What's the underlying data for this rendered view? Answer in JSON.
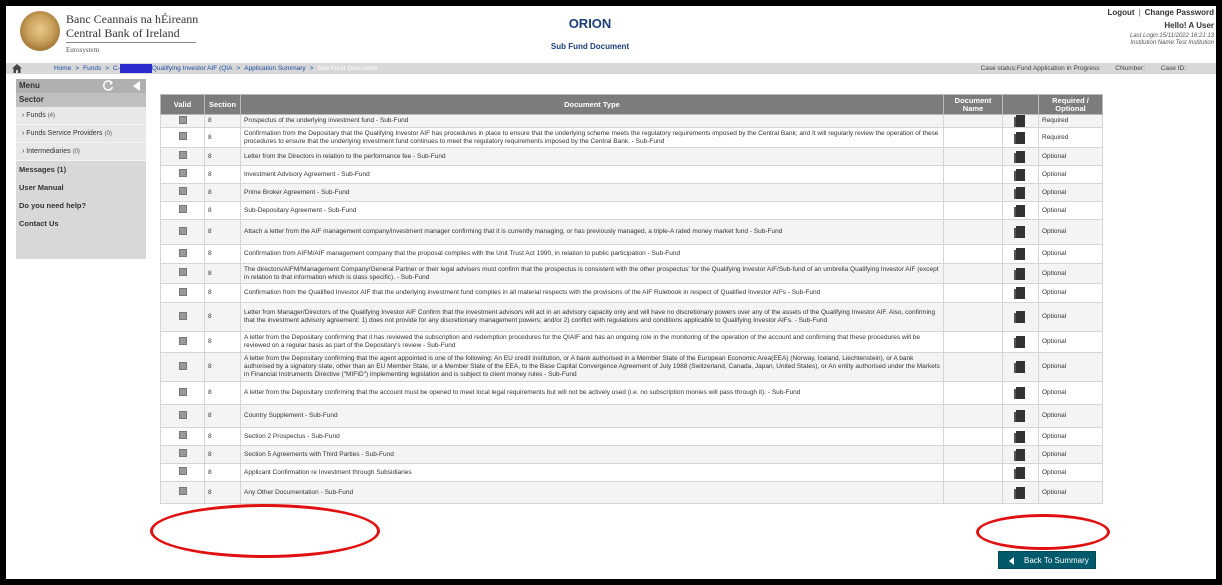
{
  "header": {
    "bank_name_irish": "Banc Ceannais na hÉireann",
    "bank_name_english": "Central Bank of Ireland",
    "eurosystem": "Eurosystem",
    "app_title": "ORION",
    "page_title": "Sub Fund Document",
    "logout": "Logout",
    "separator": "|",
    "change_password": "Change Password",
    "greeting": "Hello! A User",
    "last_login": "Last Login:15/11/2022 16:21:13",
    "institution": "Institution Name:Test Institution"
  },
  "breadcrumb": {
    "home": "Home",
    "funds": "Funds",
    "fund_prefix": "C-",
    "qiaif": "Qualifying Investor AIF (QIA",
    "app_summary": "Application Summary",
    "current": "Sub Fund Document",
    "sep": ">"
  },
  "case_info": {
    "status": "Case status:Fund Application in Progress",
    "cnumber": "CNumber:",
    "case_id": "Case ID:"
  },
  "sidebar": {
    "menu": "Menu",
    "sector": "Sector",
    "items": [
      {
        "label": "› Funds",
        "count": "(4)"
      },
      {
        "label": "› Funds Service Providers",
        "count": "(0)"
      },
      {
        "label": "› Intermediaries",
        "count": "(0)"
      }
    ],
    "messages": "Messages (1)",
    "user_manual": "User Manual",
    "help": "Do you need help?",
    "contact": "Contact Us"
  },
  "table": {
    "headers": {
      "valid": "Valid",
      "section": "Section",
      "doc_type": "Document Type",
      "doc_name": "Document Name",
      "req_opt": "Required / Optional"
    },
    "rows": [
      {
        "section": "8",
        "doc_type": "Prospectus of the underlying investment fund - Sub-Fund",
        "req": "Required"
      },
      {
        "section": "8",
        "doc_type": "Confirmation from the Depositary that the Qualifying Investor AIF has procedures in place to ensure that the underlying scheme meets the regulatory requirements imposed by the Central Bank; and It will regularly review the operation of these procedures to ensure that the underlying investment fund continues to meet the regulatory requirements imposed by the Central Bank. - Sub-Fund",
        "req": "Required"
      },
      {
        "section": "8",
        "doc_type": "Letter from the Directors in relation to the performance fee - Sub-Fund",
        "req": "Optional"
      },
      {
        "section": "8",
        "doc_type": "Investment Advisory Agreement - Sub-Fund",
        "req": "Optional"
      },
      {
        "section": "8",
        "doc_type": "Prime Broker Agreement - Sub-Fund",
        "req": "Optional"
      },
      {
        "section": "8",
        "doc_type": "Sub-Depositary Agreement - Sub-Fund",
        "req": "Optional"
      },
      {
        "section": "8",
        "doc_type": "Attach a letter from the AIF management company/investment manager confirming that it is currently managing, or has previously managed, a triple-A rated money market fund - Sub-Fund",
        "req": "Optional"
      },
      {
        "section": "8",
        "doc_type": "Confirmation from AIFM/AIF management company that the proposal complies with the Unit Trust Act 1990, in relation to public participation - Sub-Fund",
        "req": "Optional"
      },
      {
        "section": "8",
        "doc_type": "The directors/AIFM/Management Company/General Partner or their legal advisers must confirm that the prospectus is consistent with the other prospectus' for the Qualifying Investor AIF/Sub-fund of an umbrella Qualifying Investor AIF (except in relation to that information which is class specific). - Sub-Fund",
        "req": "Optional"
      },
      {
        "section": "8",
        "doc_type": "Confirmation from the Qualified Investor AIF that the underlying investment fund complies in all material respects with the provisions of the AIF Rulebook in respect of Qualified Investor AIFs - Sub-Fund",
        "req": "Optional"
      },
      {
        "section": "8",
        "doc_type": "Letter from Manager/Directors of the Qualifying Investor AIF Confirm that the investment advisors will act in an advisory capacity only and will have no discretionary powers over any of the assets of the Qualifying Investor AIF. Also, confirming that the investment advisory agreement: 1) does not provide for any discretionary management powers; and/or 2) conflict with regulations and conditions applicable to Qualifying Investor AIFs. - Sub-Fund",
        "req": "Optional"
      },
      {
        "section": "8",
        "doc_type": "A letter from the Depositary confirming that it has reviewed the subscription and redemption procedures for the QIAIF and has an ongoing role in the monitoring of the operation of the account and confirming that these procedures will be reviewed on a regular basis as part of the Depositary's review - Sub-Fund",
        "req": "Optional"
      },
      {
        "section": "8",
        "doc_type": "A letter from the Depositary confirming that the agent appointed is one of the following: An EU credit institution, or A bank authorised in a Member State of the European Economic Area(EEA) (Norway, Iceland, Liechtenstein), or A bank authorised by a signatory state, other than an EU Member State, or a Member State of the EEA, to the Base Capital Convergence Agreement of July 1988 (Switzerland, Canada, Japan, United States), or An entity authorised under the Markets in Financial Instruments Directive (\"MIFID\") implementing legislation and is subject to client money rules - Sub-Fund",
        "req": "Optional"
      },
      {
        "section": "8",
        "doc_type": "A letter from the Depositary confirming that the account must be opened to meet local legal requirements but will not be actively used (i.e. no subscription monies will pass through it). - Sub-Fund",
        "req": "Optional"
      },
      {
        "section": "8",
        "doc_type": "Country Supplement - Sub-Fund",
        "req": "Optional"
      },
      {
        "section": "8",
        "doc_type": "Section 2 Prospectus - Sub-Fund",
        "req": "Optional"
      },
      {
        "section": "8",
        "doc_type": "Section 5 Agreements with Third Parties - Sub-Fund",
        "req": "Optional"
      },
      {
        "section": "8",
        "doc_type": "Applicant Confirmation re Investment through Subsidiaries",
        "req": "Optional"
      },
      {
        "section": "8",
        "doc_type": "Any Other Documentation - Sub-Fund",
        "req": "Optional"
      }
    ]
  },
  "back_button": "Back To Summary",
  "colors": {
    "nav_blue": "#1f4ea3",
    "header_gray": "#7c7c7c",
    "back_button": "#005a6b",
    "highlight_ring": "#e01010"
  }
}
